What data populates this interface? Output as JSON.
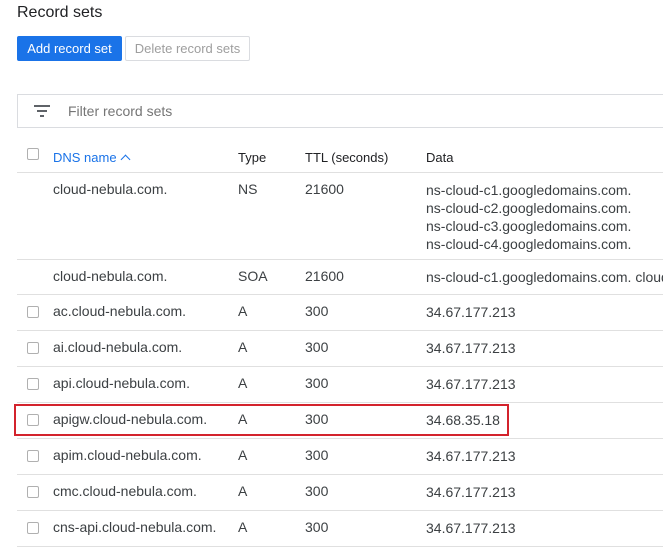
{
  "page": {
    "title": "Record sets"
  },
  "toolbar": {
    "add_label": "Add record set",
    "delete_label": "Delete record sets"
  },
  "filter": {
    "placeholder": "Filter record sets"
  },
  "table": {
    "columns": {
      "name": "DNS name",
      "type": "Type",
      "ttl": "TTL (seconds)",
      "data": "Data"
    },
    "sort": {
      "column": "DNS name",
      "direction": "ascending"
    },
    "rows": [
      {
        "name": "cloud-nebula.com.",
        "type": "NS",
        "ttl": "21600",
        "data": [
          "ns-cloud-c1.googledomains.com.",
          "ns-cloud-c2.googledomains.com.",
          "ns-cloud-c3.googledomains.com.",
          "ns-cloud-c4.googledomains.com."
        ]
      },
      {
        "name": "cloud-nebula.com.",
        "type": "SOA",
        "ttl": "21600",
        "data": [
          "ns-cloud-c1.googledomains.com. cloud"
        ]
      },
      {
        "name": "ac.cloud-nebula.com.",
        "type": "A",
        "ttl": "300",
        "data": [
          "34.67.177.213"
        ]
      },
      {
        "name": "ai.cloud-nebula.com.",
        "type": "A",
        "ttl": "300",
        "data": [
          "34.67.177.213"
        ]
      },
      {
        "name": "api.cloud-nebula.com.",
        "type": "A",
        "ttl": "300",
        "data": [
          "34.67.177.213"
        ]
      },
      {
        "name": "apigw.cloud-nebula.com.",
        "type": "A",
        "ttl": "300",
        "data": [
          "34.68.35.18"
        ]
      },
      {
        "name": "apim.cloud-nebula.com.",
        "type": "A",
        "ttl": "300",
        "data": [
          "34.67.177.213"
        ]
      },
      {
        "name": "cmc.cloud-nebula.com.",
        "type": "A",
        "ttl": "300",
        "data": [
          "34.67.177.213"
        ]
      },
      {
        "name": "cns-api.cloud-nebula.com.",
        "type": "A",
        "ttl": "300",
        "data": [
          "34.67.177.213"
        ]
      }
    ]
  },
  "highlight": {
    "row": "apigw.cloud-nebula.com.",
    "color": "#d3232c"
  },
  "colors": {
    "accent": "#1a73e8"
  }
}
